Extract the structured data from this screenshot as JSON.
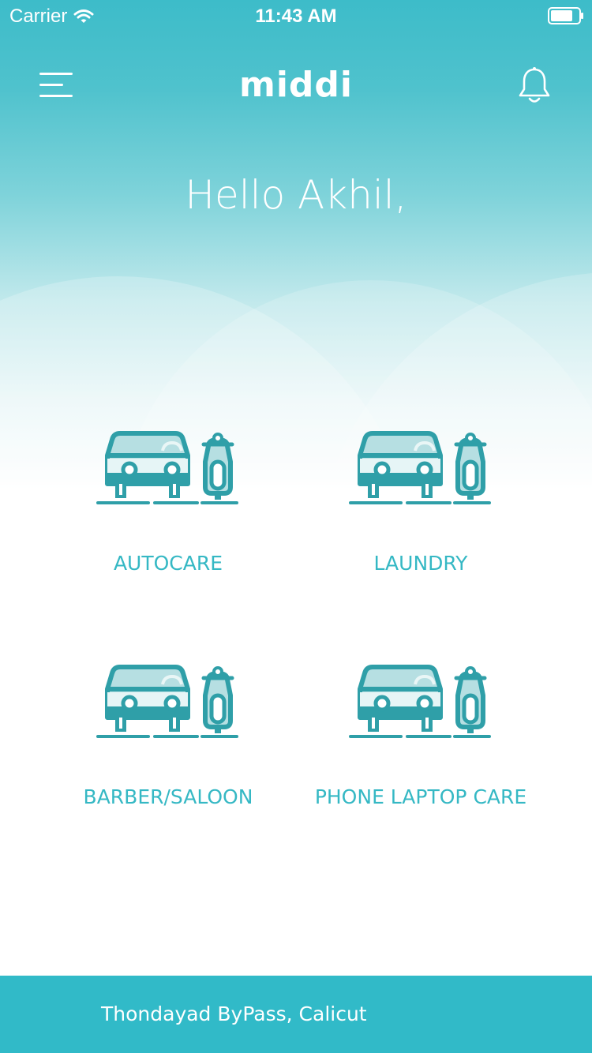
{
  "status_bar": {
    "carrier": "Carrier",
    "time": "11:43 AM"
  },
  "header": {
    "brand": "middi",
    "menu_icon": "hamburger-menu-icon",
    "notification_icon": "bell-icon"
  },
  "greeting": "Hello Akhil,",
  "services": [
    {
      "label": "AUTOCARE",
      "icon": "car-scooter-icon"
    },
    {
      "label": "LAUNDRY",
      "icon": "car-scooter-icon"
    },
    {
      "label": "BARBER/SALOON",
      "icon": "car-scooter-icon"
    },
    {
      "label": "PHONE LAPTOP CARE",
      "icon": "car-scooter-icon"
    }
  ],
  "footer": {
    "location": "Thondayad ByPass, Calicut"
  },
  "colors": {
    "accent": "#35b8c4",
    "footer_bg": "#31bac8",
    "header_gradient_top": "#3dbcc9",
    "icon_stroke": "#2f9fa8",
    "icon_fill": "#b6dfe2"
  }
}
